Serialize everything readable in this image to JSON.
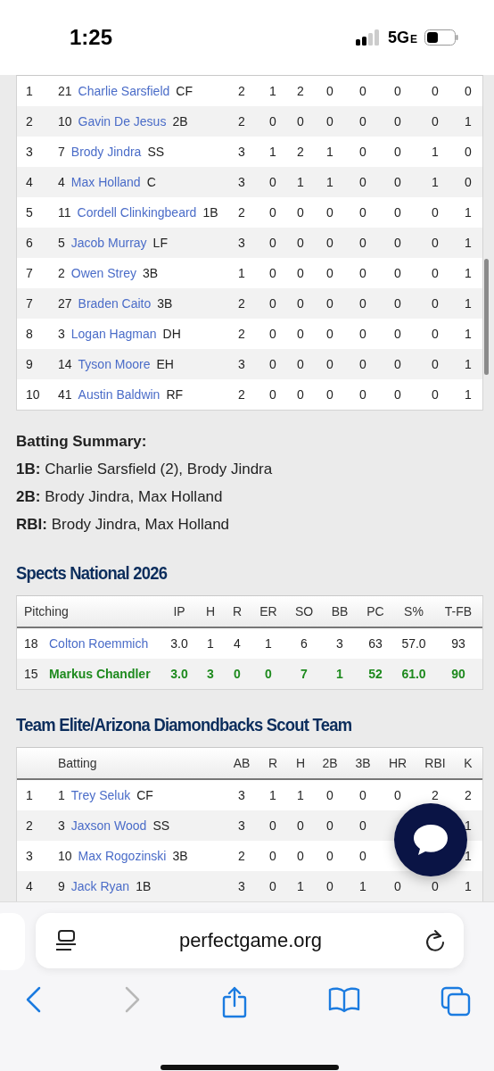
{
  "status_bar": {
    "time": "1:25",
    "network": "5G",
    "network_badge": "E"
  },
  "top_table": {
    "rows": [
      {
        "order": "1",
        "number": "21",
        "name": "Charlie Sarsfield",
        "position": "CF",
        "stats": [
          "2",
          "1",
          "2",
          "0",
          "0",
          "0",
          "0",
          "0"
        ]
      },
      {
        "order": "2",
        "number": "10",
        "name": "Gavin De Jesus",
        "position": "2B",
        "stats": [
          "2",
          "0",
          "0",
          "0",
          "0",
          "0",
          "0",
          "1"
        ]
      },
      {
        "order": "3",
        "number": "7",
        "name": "Brody Jindra",
        "position": "SS",
        "stats": [
          "3",
          "1",
          "2",
          "1",
          "0",
          "0",
          "1",
          "0"
        ]
      },
      {
        "order": "4",
        "number": "4",
        "name": "Max Holland",
        "position": "C",
        "stats": [
          "3",
          "0",
          "1",
          "1",
          "0",
          "0",
          "1",
          "0"
        ]
      },
      {
        "order": "5",
        "number": "11",
        "name": "Cordell Clinkingbeard",
        "position": "1B",
        "stats": [
          "2",
          "0",
          "0",
          "0",
          "0",
          "0",
          "0",
          "1"
        ]
      },
      {
        "order": "6",
        "number": "5",
        "name": "Jacob Murray",
        "position": "LF",
        "stats": [
          "3",
          "0",
          "0",
          "0",
          "0",
          "0",
          "0",
          "1"
        ]
      },
      {
        "order": "7",
        "number": "2",
        "name": "Owen Strey",
        "position": "3B",
        "stats": [
          "1",
          "0",
          "0",
          "0",
          "0",
          "0",
          "0",
          "1"
        ]
      },
      {
        "order": "7",
        "number": "27",
        "name": "Braden Caito",
        "position": "3B",
        "stats": [
          "2",
          "0",
          "0",
          "0",
          "0",
          "0",
          "0",
          "1"
        ]
      },
      {
        "order": "8",
        "number": "3",
        "name": "Logan Hagman",
        "position": "DH",
        "stats": [
          "2",
          "0",
          "0",
          "0",
          "0",
          "0",
          "0",
          "1"
        ]
      },
      {
        "order": "9",
        "number": "14",
        "name": "Tyson Moore",
        "position": "EH",
        "stats": [
          "3",
          "0",
          "0",
          "0",
          "0",
          "0",
          "0",
          "1"
        ]
      },
      {
        "order": "10",
        "number": "41",
        "name": "Austin Baldwin",
        "position": "RF",
        "stats": [
          "2",
          "0",
          "0",
          "0",
          "0",
          "0",
          "0",
          "1"
        ]
      }
    ]
  },
  "batting_summary": {
    "title": "Batting Summary:",
    "lines": [
      {
        "label": "1B:",
        "text": "Charlie Sarsfield (2), Brody Jindra"
      },
      {
        "label": "2B:",
        "text": "Brody Jindra, Max Holland"
      },
      {
        "label": "RBI:",
        "text": "Brody Jindra, Max Holland"
      }
    ]
  },
  "pitching": {
    "title": "Spects National 2026",
    "columns": [
      "Pitching",
      "IP",
      "H",
      "R",
      "ER",
      "SO",
      "BB",
      "PC",
      "S%",
      "T-FB"
    ],
    "rows": [
      {
        "number": "18",
        "name": "Colton Roemmich",
        "winner": false,
        "stats": [
          "3.0",
          "1",
          "4",
          "1",
          "6",
          "3",
          "63",
          "57.0",
          "93"
        ]
      },
      {
        "number": "15",
        "name": "Markus Chandler",
        "winner": true,
        "stats": [
          "3.0",
          "3",
          "0",
          "0",
          "7",
          "1",
          "52",
          "61.0",
          "90"
        ]
      }
    ]
  },
  "batting": {
    "title": "Team Elite/Arizona Diamondbacks Scout Team",
    "columns": [
      "Batting",
      "AB",
      "R",
      "H",
      "2B",
      "3B",
      "HR",
      "RBI",
      "K"
    ],
    "rows": [
      {
        "order": "1",
        "number": "1",
        "name": "Trey Seluk",
        "position": "CF",
        "stats": {
          "ab": "3",
          "r": "1",
          "h": "1",
          "doubles": "0",
          "triples": "0",
          "hr": "0",
          "rbi": "2",
          "k": "2"
        }
      },
      {
        "order": "2",
        "number": "3",
        "name": "Jaxson Wood",
        "position": "SS",
        "stats": {
          "ab": "3",
          "r": "0",
          "h": "0",
          "doubles": "0",
          "triples": "0",
          "k": "1"
        }
      },
      {
        "order": "3",
        "number": "10",
        "name": "Max Rogozinski",
        "position": "3B",
        "stats": {
          "ab": "2",
          "r": "0",
          "h": "0",
          "doubles": "0",
          "triples": "0",
          "k": "1"
        }
      },
      {
        "order": "4",
        "number": "9",
        "name": "Jack Ryan",
        "position": "1B",
        "stats": {
          "ab": "3",
          "r": "0",
          "h": "1",
          "doubles": "0",
          "triples": "1",
          "hr": "0",
          "rbi": "0",
          "k": "1"
        }
      }
    ]
  },
  "browser": {
    "url": "perfectgame.org",
    "back_disabled": false,
    "forward_disabled": true
  }
}
